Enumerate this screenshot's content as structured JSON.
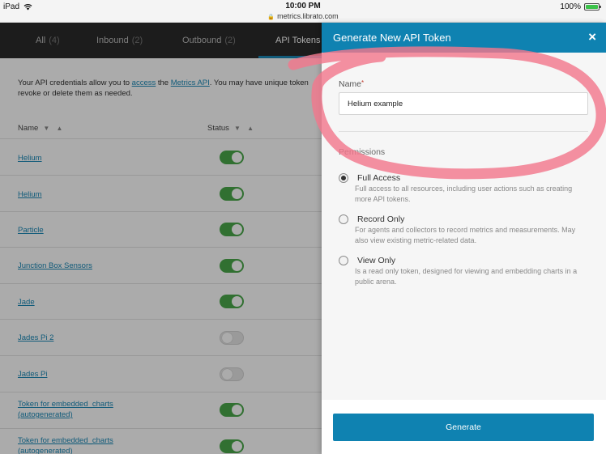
{
  "status_bar": {
    "device": "iPad",
    "time": "10:00 PM",
    "url": "metrics.librato.com",
    "battery": "100%"
  },
  "tabs": [
    {
      "label": "All",
      "count": "(4)"
    },
    {
      "label": "Inbound",
      "count": "(2)"
    },
    {
      "label": "Outbound",
      "count": "(2)"
    },
    {
      "label": "API Tokens",
      "count": ""
    }
  ],
  "intro": {
    "prefix": "Your API credentials allow you to ",
    "link1": "access",
    "middle": " the ",
    "link2": "Metrics API",
    "suffix": ". You may have unique token",
    "line2": "revoke or delete them as needed."
  },
  "columns": {
    "name": "Name",
    "status": "Status",
    "sort_arrows": "▼ ▲"
  },
  "tokens": [
    {
      "name": "Helium",
      "enabled": true
    },
    {
      "name": "Helium",
      "enabled": true
    },
    {
      "name": "Particle",
      "enabled": true
    },
    {
      "name": "Junction Box Sensors",
      "enabled": true
    },
    {
      "name": "Jade",
      "enabled": true
    },
    {
      "name": "Jades Pi 2",
      "enabled": false
    },
    {
      "name": "Jades Pi",
      "enabled": false
    },
    {
      "name": "Token for embedded_charts (autogenerated)",
      "enabled": true
    },
    {
      "name": "Token for embedded_charts (autogenerated)",
      "enabled": true
    }
  ],
  "drawer": {
    "title": "Generate New API Token",
    "close": "×",
    "name_label": "Name",
    "required_mark": "*",
    "name_value": "Helium example",
    "permissions_label": "Permissions",
    "options": [
      {
        "title": "Full Access",
        "desc": "Full access to all resources, including user actions such as creating more API tokens.",
        "checked": true
      },
      {
        "title": "Record Only",
        "desc": "For agents and collectors to record metrics and measurements. May also view existing metric-related data.",
        "checked": false
      },
      {
        "title": "View Only",
        "desc": "Is a read only token, designed for viewing and embedding charts in a public arena.",
        "checked": false
      }
    ],
    "generate": "Generate"
  },
  "colors": {
    "accent": "#0f82b1",
    "toggle_on": "#49a84a",
    "annotation": "#f2788c"
  }
}
